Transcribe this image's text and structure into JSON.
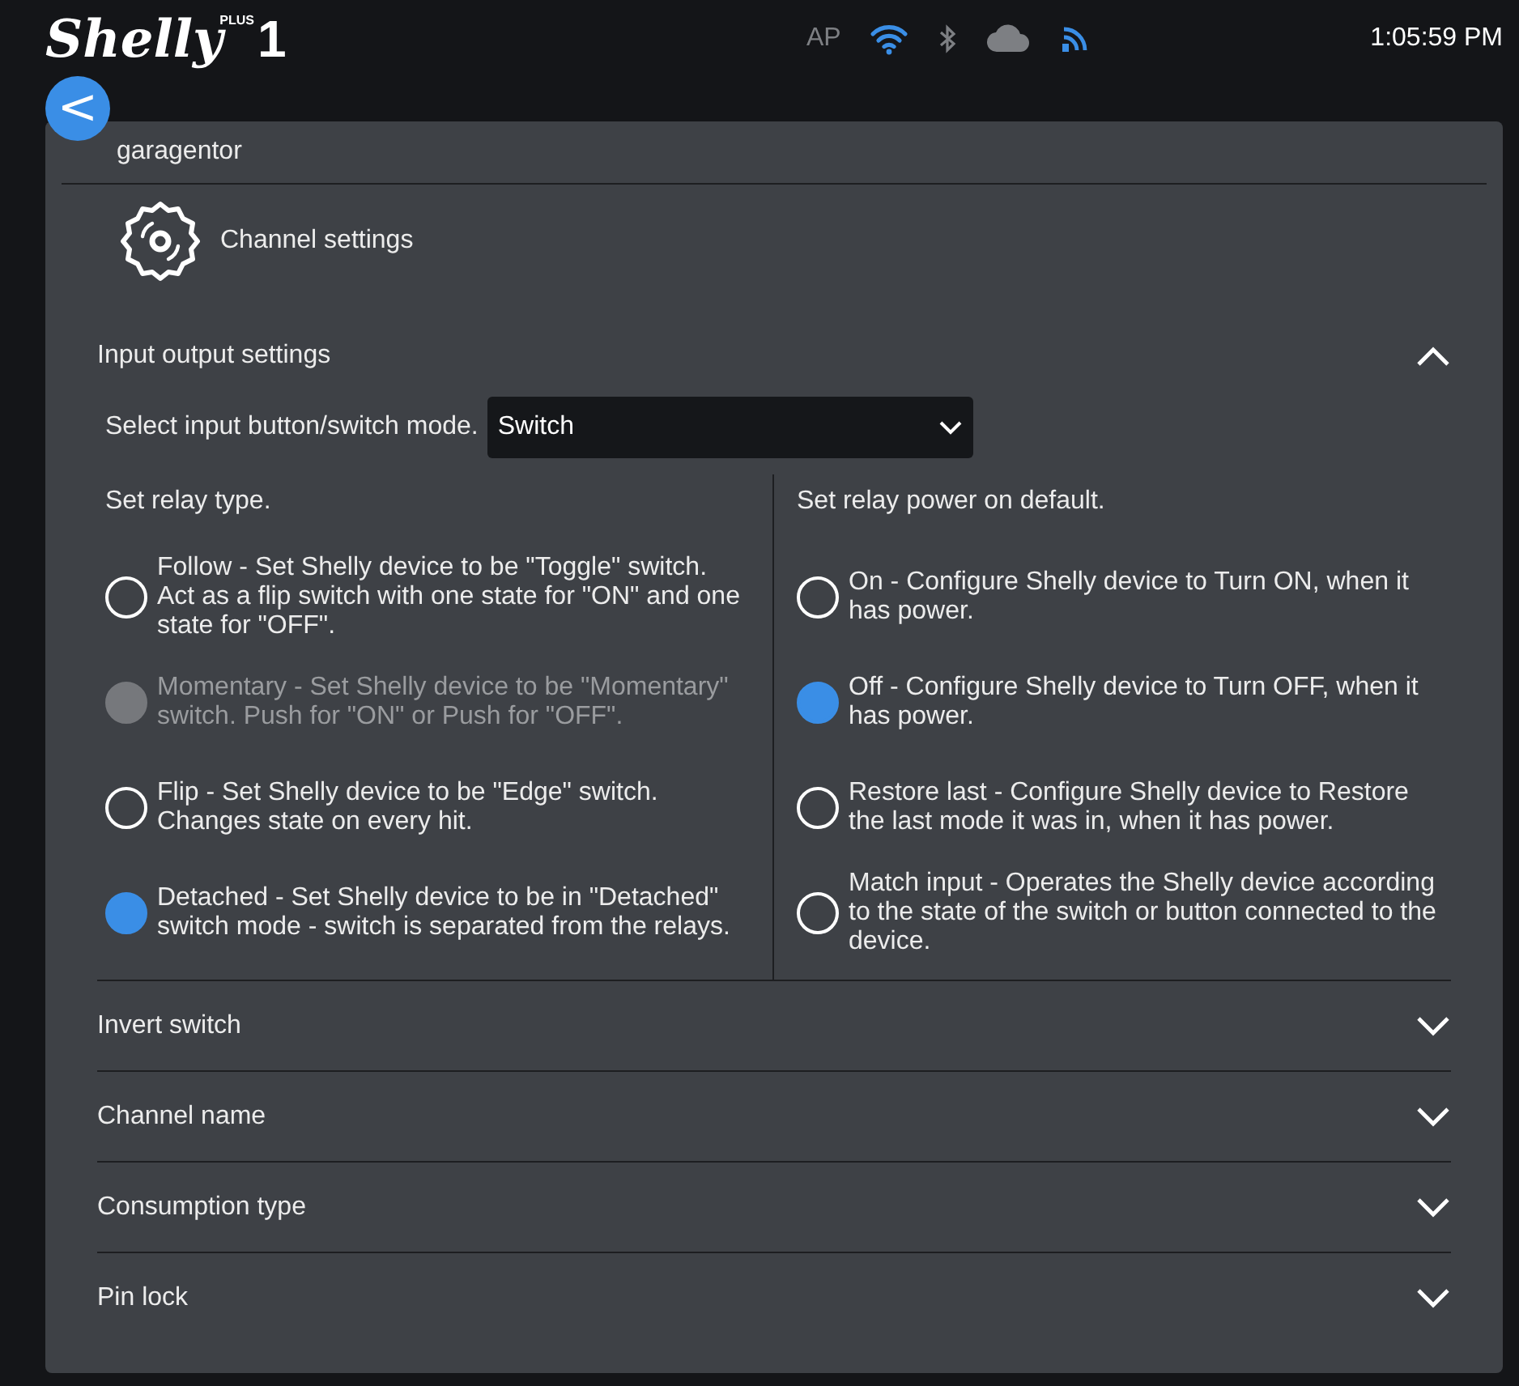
{
  "header": {
    "logo": {
      "name": "Shelly",
      "plus": "PLUS",
      "model": "1"
    },
    "status": {
      "ap": "AP"
    },
    "time": "1:05:59 PM"
  },
  "back_button": {
    "label": "<"
  },
  "device_name": "garagentor",
  "page_title": "Channel settings",
  "section": {
    "title": "Input output settings",
    "expanded": true,
    "mode_label": "Select input button/switch mode.",
    "mode_value": "Switch",
    "relay_type": {
      "title": "Set relay type.",
      "options": [
        {
          "label": "Follow - Set Shelly device to be \"Toggle\" switch. Act as a flip switch with one state for \"ON\" and one state for \"OFF\".",
          "selected": false,
          "disabled": false
        },
        {
          "label": "Momentary - Set Shelly device to be \"Momentary\" switch. Push for \"ON\" or Push for \"OFF\".",
          "selected": false,
          "disabled": true
        },
        {
          "label": "Flip - Set Shelly device to be \"Edge\" switch. Changes state on every hit.",
          "selected": false,
          "disabled": false
        },
        {
          "label": "Detached - Set Shelly device to be in \"Detached\" switch mode - switch is separated from the relays.",
          "selected": true,
          "disabled": false
        }
      ]
    },
    "power_default": {
      "title": "Set relay power on default.",
      "options": [
        {
          "label": "On - Configure Shelly device to Turn ON, when it has power.",
          "selected": false,
          "disabled": false
        },
        {
          "label": "Off - Configure Shelly device to Turn OFF, when it has power.",
          "selected": true,
          "disabled": false
        },
        {
          "label": "Restore last - Configure Shelly device to Restore the last mode it was in, when it has power.",
          "selected": false,
          "disabled": false
        },
        {
          "label": "Match input - Operates the Shelly device according to the state of the switch or button connected to the device.",
          "selected": false,
          "disabled": false
        }
      ]
    }
  },
  "collapsed_sections": [
    {
      "title": "Invert switch",
      "expanded": false
    },
    {
      "title": "Channel name",
      "expanded": false
    },
    {
      "title": "Consumption type",
      "expanded": false
    },
    {
      "title": "Pin lock",
      "expanded": false
    }
  ]
}
